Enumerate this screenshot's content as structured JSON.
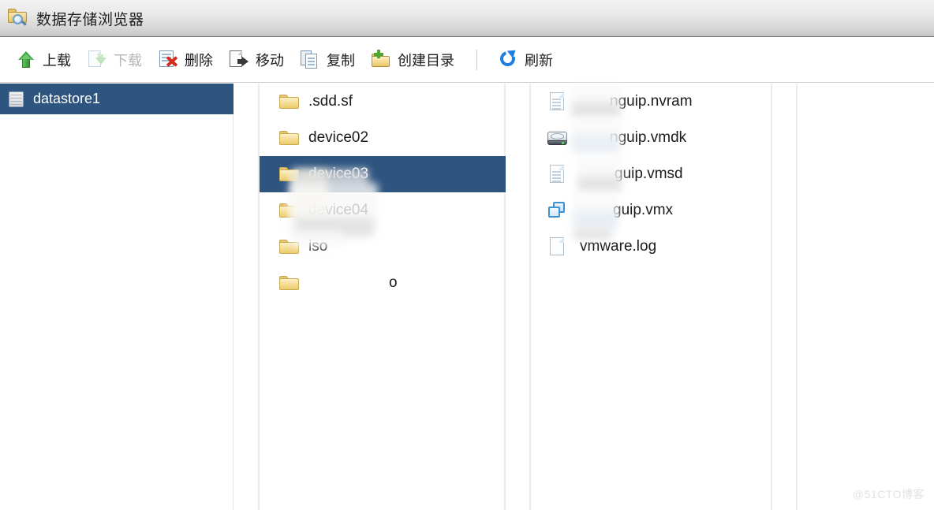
{
  "window": {
    "title": "数据存储浏览器",
    "title_icon": "folder-search-icon"
  },
  "toolbar": {
    "buttons": [
      {
        "label": "上载",
        "icon": "upload-icon",
        "disabled": false
      },
      {
        "label": "下载",
        "icon": "download-icon",
        "disabled": true
      },
      {
        "label": "删除",
        "icon": "delete-icon",
        "disabled": false
      },
      {
        "label": "移动",
        "icon": "move-icon",
        "disabled": false
      },
      {
        "label": "复制",
        "icon": "copy-icon",
        "disabled": false
      },
      {
        "label": "创建目录",
        "icon": "new-folder-icon",
        "disabled": false
      },
      {
        "label": "刷新",
        "icon": "refresh-icon",
        "disabled": false
      }
    ],
    "separator_before_index": 6
  },
  "tree": {
    "datastore": {
      "label": "datastore1",
      "icon": "datastore-icon",
      "selected": true
    }
  },
  "folders": {
    "items": [
      {
        "label": ".sdd.sf",
        "icon": "folder-icon",
        "selected": false,
        "redacted": false
      },
      {
        "label": "device02",
        "icon": "folder-icon",
        "selected": false,
        "redacted": false
      },
      {
        "label": "device03",
        "icon": "folder-icon",
        "selected": true,
        "redacted": false
      },
      {
        "label": "device04",
        "icon": "folder-icon",
        "selected": false,
        "redacted": false
      },
      {
        "label": "iso",
        "icon": "folder-icon",
        "selected": false,
        "redacted": false
      },
      {
        "label": "o",
        "icon": "folder-icon",
        "selected": false,
        "redacted": true
      }
    ]
  },
  "files": {
    "items": [
      {
        "label": "nguip.nvram",
        "icon": "document-lines-icon",
        "redacted": true
      },
      {
        "label": "nguip.vmdk",
        "icon": "hard-disk-icon",
        "redacted": true
      },
      {
        "label": "guip.vmsd",
        "icon": "document-lines-icon",
        "redacted": true
      },
      {
        "label": "guip.vmx",
        "icon": "vmx-icon",
        "redacted": true
      },
      {
        "label": "vmware.log",
        "icon": "document-blank-icon",
        "redacted": false
      }
    ]
  },
  "watermark": {
    "text": "@51CTO博客"
  },
  "colors": {
    "selection": "#2e5580",
    "titlebar_border": "#6f6f6f",
    "folder_yellow": "#f6de96",
    "accent_blue": "#1f7fe0",
    "delete_red": "#d52b1e",
    "upload_green": "#3fa33f"
  }
}
